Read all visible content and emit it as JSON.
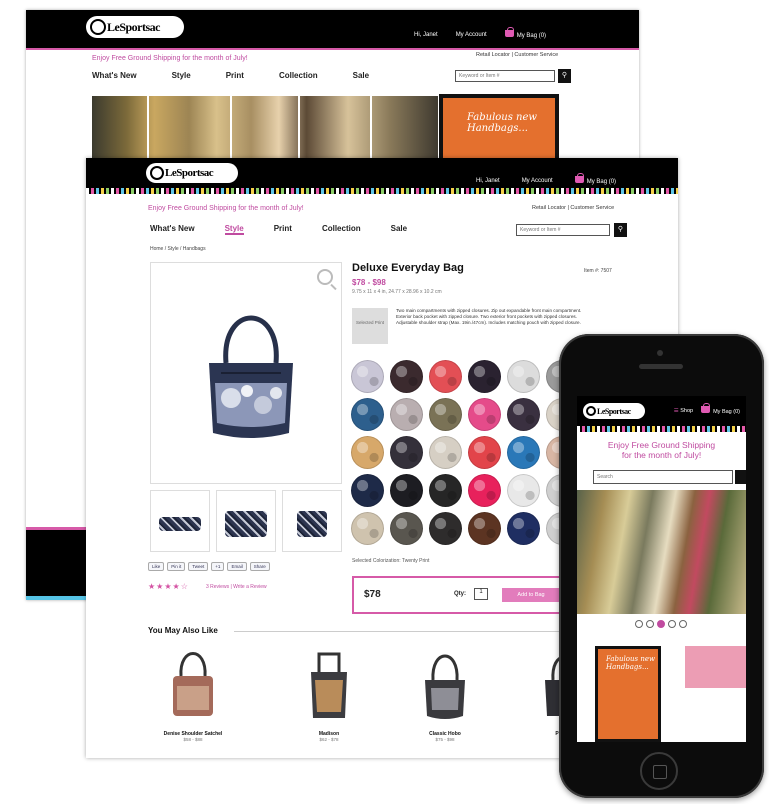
{
  "brand": {
    "logo": "LeSportsac",
    "pink": "#d65aa8",
    "black": "#000000"
  },
  "back_window": {
    "top_links": [
      "Hi, Janet",
      "My Account",
      "My Bag (0)"
    ],
    "promo": "Enjoy Free Ground Shipping for the month of July!",
    "util_links": "Retail Locator | Customer Service",
    "nav": [
      "What's New",
      "Style",
      "Print",
      "Collection",
      "Sale"
    ],
    "search_placeholder": "Keyword or Item #",
    "ad_text": "Fabulous new Handbags..."
  },
  "front_window": {
    "top_links": [
      "Hi, Janet",
      "My Account",
      "My Bag (0)"
    ],
    "promo": "Enjoy Free Ground Shipping for the month of July!",
    "util_links": "Retail Locator | Customer Service",
    "nav": [
      "What's New",
      "Style",
      "Print",
      "Collection",
      "Sale"
    ],
    "search_placeholder": "Keyword or Item #",
    "breadcrumb": "Home / Style / Handbags",
    "product": {
      "title": "Deluxe Everyday Bag",
      "price_range": "$78 - $98",
      "dims": "9.75 x 11 x 4 in, 24.77 x 28.96 x 10.2 cm",
      "item_no": "Item #: 7507",
      "swatch_placeholder": "Selected Print",
      "description": "Two main compartments with zipped closures. Zip out expandable front main compartment. Exterior back pocket with zipped closure. Two exterior front pockets with zipped closures. Adjustable shoulder strap (Max. 19in./47cm). Includes matching pouch with zipped closure.",
      "swatch_colors": [
        "#c9c6d6",
        "#3b2a2e",
        "#e34f55",
        "#2a2230",
        "#dcdcdc",
        "#9a9a9a",
        "#2d5f8d",
        "#b9aeb0",
        "#7a7256",
        "#e54b8a",
        "#3a3040",
        "#d9d2c7",
        "#d7a86a",
        "#34303a",
        "#d6cfc4",
        "#e2444a",
        "#2a78b8",
        "#d8b6a4",
        "#1e2a48",
        "#1d1d22",
        "#262626",
        "#e8215c",
        "#e8e8e8",
        "#cfcfcf",
        "#cfc3ae",
        "#59564f",
        "#2e2c2c",
        "#5c3422",
        "#1f2e62",
        "#cfcfcf"
      ],
      "selected_color": "Selected Colorization: Twenty Print",
      "cart_price": "$78",
      "qty_label": "Qty:",
      "qty_value": "1",
      "add_to_bag": "Add to Bag",
      "stars": "★★★★☆",
      "reviews": "3 Reviews | Write a Review",
      "share": [
        "Like",
        "Pin it",
        "Tweet",
        "+1",
        "Email",
        "Share"
      ]
    },
    "ymal_title": "You May Also Like",
    "recommendations": [
      {
        "name": "Denise Shoulder Satchel",
        "price": "$58 - $88"
      },
      {
        "name": "Madison",
        "price": "$62 - $78"
      },
      {
        "name": "Classic Hobo",
        "price": "$75 - $98"
      },
      {
        "name": "Pouch",
        "price": ""
      }
    ]
  },
  "phone": {
    "links": [
      "Shop",
      "My Bag (0)"
    ],
    "promo_line1": "Enjoy Free Ground Shipping",
    "promo_line2": "for the month of July!",
    "search_placeholder": "Search",
    "ad_text": "Fabulous new Handbags..."
  }
}
